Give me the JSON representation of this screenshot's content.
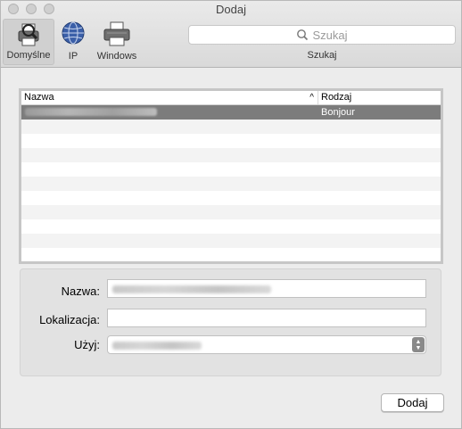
{
  "window": {
    "title": "Dodaj"
  },
  "toolbar": {
    "tabs": [
      {
        "label": "Domyślne",
        "icon": "default-printer-icon",
        "selected": true
      },
      {
        "label": "IP",
        "icon": "globe-icon",
        "selected": false
      },
      {
        "label": "Windows",
        "icon": "printer-icon",
        "selected": false
      }
    ],
    "search": {
      "placeholder": "Szukaj",
      "caption": "Szukaj"
    }
  },
  "table": {
    "columns": {
      "name": "Nazwa",
      "kind": "Rodzaj"
    },
    "rows": [
      {
        "name": "",
        "kind": "Bonjour",
        "selected": true
      }
    ]
  },
  "form": {
    "name_label": "Nazwa:",
    "location_label": "Lokalizacja:",
    "use_label": "Użyj:"
  },
  "actions": {
    "add_label": "Dodaj"
  }
}
